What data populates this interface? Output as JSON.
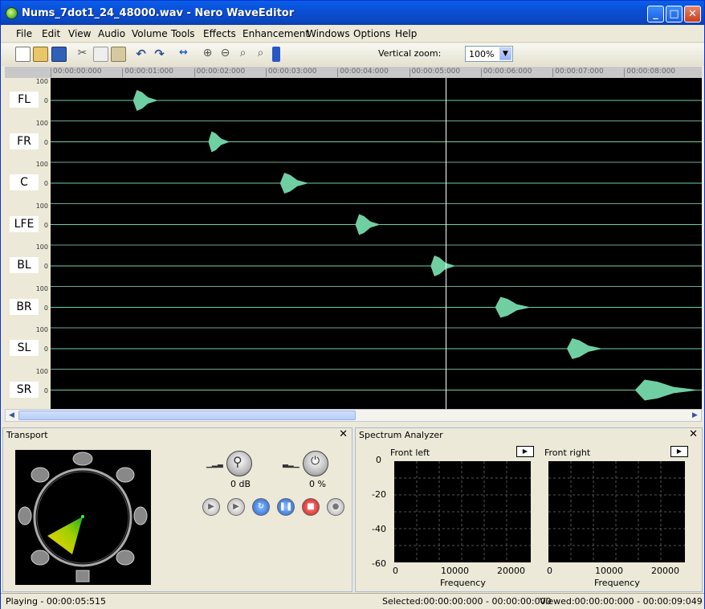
{
  "window": {
    "title": "Nums_7dot1_24_48000.wav - Nero WaveEditor"
  },
  "titlebar_buttons": {
    "minimize": "_",
    "maximize": "□",
    "close": "✕"
  },
  "menu": [
    "File",
    "Edit",
    "View",
    "Audio",
    "Volume",
    "Tools",
    "Effects",
    "Enhancement",
    "Windows",
    "Options",
    "Help"
  ],
  "toolbar": {
    "icons": [
      "new-file-icon",
      "open-folder-icon",
      "save-icon",
      "cut-icon",
      "copy-icon",
      "paste-icon",
      "undo-icon",
      "redo-icon",
      "fit-width-icon",
      "zoom-in-icon",
      "zoom-out-icon",
      "zoom-selection-icon",
      "zoom-full-icon"
    ],
    "vertical_zoom_label": "Vertical zoom:",
    "vertical_zoom_value": "100%"
  },
  "timeline": {
    "ticks": [
      "00:00:00:000",
      "00:00:01:000",
      "00:00:02:000",
      "00:00:03:000",
      "00:00:04:000",
      "00:00:05:000",
      "00:00:06:000",
      "00:00:07:000",
      "00:00:08:000"
    ],
    "playhead_seconds": 5.515,
    "total_seconds": 9.049
  },
  "waveform": {
    "color": "#6fcfa3",
    "scale_top": "100",
    "scale_mid": "0",
    "channels": [
      {
        "label": "FL",
        "burst_start": 1.15,
        "burst_end": 1.5
      },
      {
        "label": "FR",
        "burst_start": 2.2,
        "burst_end": 2.5
      },
      {
        "label": "C",
        "burst_start": 3.2,
        "burst_end": 3.6
      },
      {
        "label": "LFE",
        "burst_start": 4.25,
        "burst_end": 4.6
      },
      {
        "label": "BL",
        "burst_start": 5.3,
        "burst_end": 5.65
      },
      {
        "label": "BR",
        "burst_start": 6.2,
        "burst_end": 6.7
      },
      {
        "label": "SL",
        "burst_start": 7.2,
        "burst_end": 7.7
      },
      {
        "label": "SR",
        "burst_start": 8.15,
        "burst_end": 9.049
      }
    ]
  },
  "transport": {
    "title": "Transport",
    "close": "✕",
    "volume_value": "0 dB",
    "balance_value": "0 %",
    "buttons": [
      "play-button",
      "play-selection-button",
      "loop-button",
      "pause-button",
      "stop-button",
      "record-button"
    ]
  },
  "spectrum": {
    "title": "Spectrum Analyzer",
    "close": "✕",
    "play_glyph": "▶",
    "xlabel": "Frequency",
    "yticks": [
      "0",
      "-20",
      "-40",
      "-60"
    ],
    "xticks": [
      "0",
      "10000",
      "20000"
    ],
    "panels": [
      {
        "name": "Front left"
      },
      {
        "name": "Front right"
      }
    ]
  },
  "status": {
    "left": "Playing - 00:00:05:515",
    "selected": "Selected:00:00:00:000 - 00:00:00:000",
    "viewed": "Viewed:00:00:00:000 - 00:00:09:049"
  }
}
